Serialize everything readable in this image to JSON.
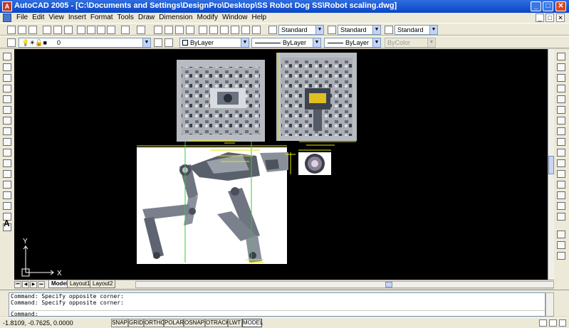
{
  "window": {
    "title": "AutoCAD 2005 - [C:\\Documents and Settings\\DesignPro\\Desktop\\SS Robot Dog SS\\Robot scaling.dwg]",
    "app_icon_text": "A",
    "minimize": "_",
    "maximize": "□",
    "close": "✕"
  },
  "menu": {
    "items": [
      "File",
      "Edit",
      "View",
      "Insert",
      "Format",
      "Tools",
      "Draw",
      "Dimension",
      "Modify",
      "Window",
      "Help"
    ]
  },
  "styles_toolbar": {
    "text_style": "Standard",
    "dim_style": "Standard",
    "table_style": "Standard"
  },
  "layers_toolbar": {
    "current_layer": "0",
    "color": "ByLayer",
    "linetype": "ByLayer",
    "lineweight": "ByLayer",
    "plot_style": "ByColor"
  },
  "ucs": {
    "y_label": "Y",
    "x_label": "X"
  },
  "layout_tabs": [
    {
      "label": "Model",
      "active": true
    },
    {
      "label": "Layout1",
      "active": false
    },
    {
      "label": "Layout2",
      "active": false
    }
  ],
  "command": {
    "history": [
      "Command: Specify opposite corner:",
      "Command: Specify opposite corner:"
    ],
    "prompt": "Command:"
  },
  "status": {
    "coordinates": "-1.8109, -0.7625, 0.0000",
    "buttons": [
      {
        "label": "SNAP",
        "on": false
      },
      {
        "label": "GRID",
        "on": false
      },
      {
        "label": "ORTHO",
        "on": false
      },
      {
        "label": "POLAR",
        "on": false
      },
      {
        "label": "OSNAP",
        "on": false
      },
      {
        "label": "OTRACK",
        "on": false
      },
      {
        "label": "LWT",
        "on": false
      },
      {
        "label": "MODEL",
        "on": true
      }
    ]
  },
  "draw_toolbar_text_icon": "A",
  "colors": {
    "canvas": "#000000",
    "dimension_lines": "#e6e600",
    "guide_lines": "#33cc33",
    "title_bar": "#0a45c6"
  }
}
